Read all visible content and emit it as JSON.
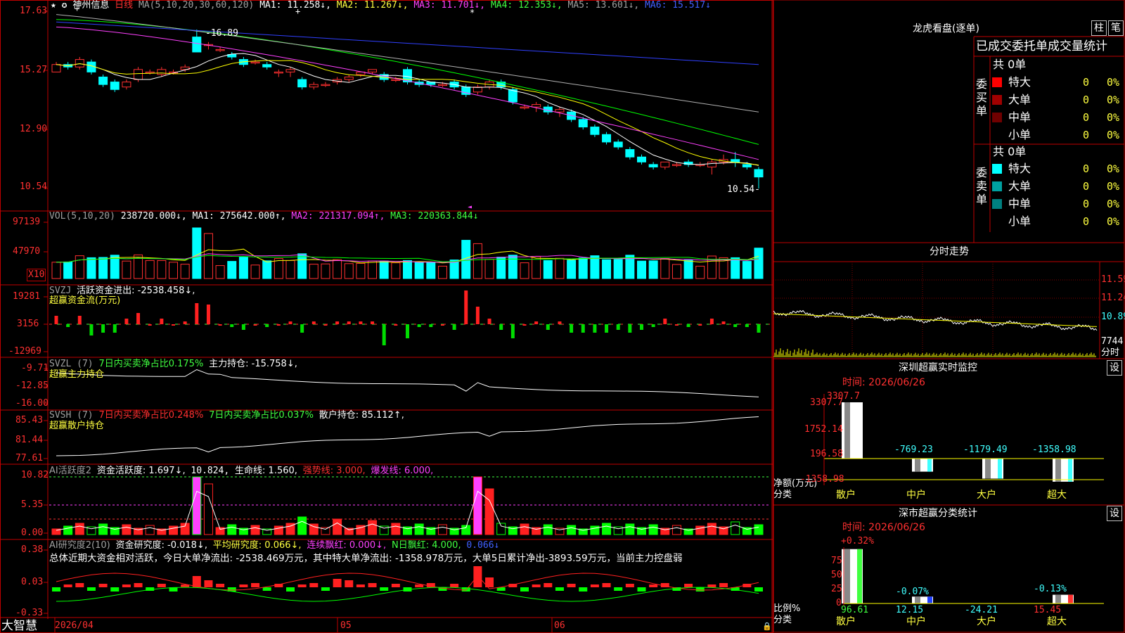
{
  "colors": {
    "up": "#ff2020",
    "down": "#00ffff",
    "border": "#c00000",
    "ma1": "#ffffff",
    "ma2": "#ffff00",
    "ma3": "#ff40ff",
    "ma4": "#00ff00",
    "ma5": "#c0c0c0",
    "ma6": "#2030ff"
  },
  "main": {
    "header": {
      "stars": "★ ✪",
      "name": "神州信息",
      "period": "日线",
      "ma_params": "MA(5,10,20,30,60,120)",
      "ma1": "MA1: 11.258↓,",
      "ma2": "MA2: 11.267↓,",
      "ma3": "MA3: 11.701↓,",
      "ma4": "MA4: 12.353↓,",
      "ma5": "MA5: 13.601↓,",
      "ma6": "MA6: 15.517↓"
    },
    "yticks": [
      "17.63",
      "15.27",
      "12.90",
      "10.54"
    ],
    "high_label": "16.89",
    "low_label": "10.54"
  },
  "vol": {
    "header": {
      "params": "VOL(5,10,20)",
      "v": "238720.000↓,",
      "ma1": "MA1: 275642.000↑,",
      "ma2": "MA2: 221317.094↑,",
      "ma3": "MA3: 220363.844↓"
    },
    "yticks": [
      "97139",
      "47970"
    ],
    "unit": "X10"
  },
  "svzj": {
    "header": {
      "name": "SVZJ",
      "l1": "活跃资金进出: -2538.458↓,",
      "l2": "超赢资金流(万元)"
    },
    "yticks": [
      "19281",
      "3156",
      "-12969"
    ]
  },
  "svzl": {
    "header": {
      "name": "SVZL (7)",
      "l1": "7日内买卖净占比0.175%",
      "l2": "主力持仓: -15.758↓,",
      "l3": "超赢主力持仓"
    },
    "yticks": [
      "-9.71",
      "-12.85",
      "-16.00"
    ]
  },
  "svsh": {
    "header": {
      "name": "SVSH (7)",
      "l1": "7日内买卖净占比0.248%",
      "l2": "7日内买卖净占比0.037%",
      "l3": "散户持仓: 85.112↑,",
      "l4": "超赢散户持仓"
    },
    "yticks": [
      "85.43",
      "81.44",
      "77.61"
    ]
  },
  "ai1": {
    "header": {
      "name": "AI活跃度2",
      "l1": "资金活跃度: 1.697↓,",
      "l2": "10.824,",
      "l3": "生命线: 1.560,",
      "l4": "强势线: 3.000,",
      "l5": "爆发线: 6.000,"
    },
    "yticks": [
      "10.82",
      "5.35",
      "0.00"
    ]
  },
  "ai2": {
    "header": {
      "name": "AI研究度2(10)",
      "l1": "资金研究度: -0.018↓,",
      "l2": "平均研究度: 0.066↓,",
      "l3": "连续飘红: 0.000↓,",
      "l4": "N日飘红: 4.000,",
      "l5": "0.066↓"
    },
    "summary": "总体近期大资金相对活跃，今日大单净流出: -2538.469万元，其中特大单净流出: -1358.978万元，大单5日累计净出-3893.59万元，当前主力控盘弱",
    "yticks": [
      "0.38",
      "0.03",
      "-0.33"
    ]
  },
  "xaxis": {
    "brand": "大智慧",
    "labels": [
      "2026/04",
      "05",
      "06"
    ]
  },
  "right": {
    "lhb": {
      "title": "龙虎看盘(逐单)",
      "btn1": "柱",
      "btn2": "笔",
      "subtitle": "已成交委托单成交量统计",
      "buy": {
        "label": "委买单",
        "total": "共 0单",
        "rows": [
          {
            "name": "特大",
            "v": "0",
            "p": "0%",
            "c": "#ff0000"
          },
          {
            "name": "大单",
            "v": "0",
            "p": "0%",
            "c": "#a00000"
          },
          {
            "name": "中单",
            "v": "0",
            "p": "0%",
            "c": "#700000"
          },
          {
            "name": "小单",
            "v": "0",
            "p": "0%",
            "c": ""
          }
        ]
      },
      "sell": {
        "label": "委卖单",
        "total": "共 0单",
        "rows": [
          {
            "name": "特大",
            "v": "0",
            "p": "0%",
            "c": "#00ffff"
          },
          {
            "name": "大单",
            "v": "0",
            "p": "0%",
            "c": "#00a0a0"
          },
          {
            "name": "中单",
            "v": "0",
            "p": "0%",
            "c": "#008080"
          },
          {
            "name": "小单",
            "v": "0",
            "p": "0%",
            "c": ""
          }
        ]
      }
    },
    "fs": {
      "title": "分时走势",
      "yticks": [
        "11.59",
        "11.24",
        "10.89",
        "7744",
        "分时"
      ]
    },
    "sz": {
      "title": "深圳超赢实时监控",
      "btn": "设",
      "time": "时间: 2026/06/26",
      "ylabel": "净额(万元)",
      "xlabel": "分类",
      "yticks": [
        "3307.7",
        "1752.14",
        "196.58",
        "-1358.98"
      ],
      "bars": [
        {
          "cat": "散户",
          "val": 3307.7,
          "label": "3307.7"
        },
        {
          "cat": "中户",
          "val": -769.23,
          "label": "-769.23"
        },
        {
          "cat": "大户",
          "val": -1179.49,
          "label": "-1179.49"
        },
        {
          "cat": "超大",
          "val": -1358.98,
          "label": "-1358.98"
        }
      ]
    },
    "ss": {
      "title": "深市超赢分类统计",
      "btn": "设",
      "time": "时间: 2026/06/26",
      "ylabel": "比例%",
      "xlabel": "分类",
      "yticks": [
        "75",
        "50",
        "25",
        "0"
      ],
      "bars": [
        {
          "cat": "散户",
          "val": 96.61,
          "top": "+0.32%",
          "bottom": "96.61"
        },
        {
          "cat": "中户",
          "val": 12.15,
          "top": "-0.07%",
          "bottom": "12.15"
        },
        {
          "cat": "大户",
          "val": 0,
          "top": "",
          "bottom": "-24.21"
        },
        {
          "cat": "超大",
          "val": 15.45,
          "top": "-0.13%",
          "bottom": "15.45"
        }
      ]
    }
  },
  "chart_data": {
    "type": "candlestick",
    "candles": [
      [
        15.2,
        15.5,
        15.2,
        15.6
      ],
      [
        15.5,
        15.4,
        15.3,
        15.6
      ],
      [
        15.4,
        15.7,
        15.3,
        15.8
      ],
      [
        15.6,
        15.2,
        15.1,
        15.7
      ],
      [
        15.0,
        14.7,
        14.6,
        15.1
      ],
      [
        14.8,
        14.5,
        14.4,
        14.9
      ],
      [
        14.6,
        14.8,
        14.5,
        14.9
      ],
      [
        14.9,
        15.3,
        14.8,
        15.4
      ],
      [
        15.2,
        15.2,
        15.1,
        15.3
      ],
      [
        15.1,
        15.3,
        15.0,
        15.4
      ],
      [
        15.2,
        15.2,
        15.1,
        15.3
      ],
      [
        15.3,
        15.4,
        15.2,
        15.5
      ],
      [
        16.6,
        16.0,
        16.0,
        16.9
      ],
      [
        16.3,
        16.3,
        16.1,
        16.4
      ],
      [
        16.1,
        16.1,
        16.0,
        16.2
      ],
      [
        15.9,
        15.8,
        15.7,
        16.0
      ],
      [
        15.7,
        15.5,
        15.4,
        15.8
      ],
      [
        15.6,
        15.6,
        15.5,
        15.7
      ],
      [
        15.5,
        15.4,
        15.3,
        15.6
      ],
      [
        15.2,
        15.2,
        15.0,
        15.3
      ],
      [
        15.2,
        15.3,
        15.0,
        15.4
      ],
      [
        14.9,
        14.6,
        14.5,
        15.0
      ],
      [
        14.6,
        14.7,
        14.5,
        14.8
      ],
      [
        14.7,
        14.7,
        14.6,
        14.8
      ],
      [
        14.8,
        14.9,
        14.7,
        15.0
      ],
      [
        14.9,
        15.0,
        14.8,
        15.1
      ],
      [
        15.1,
        15.2,
        15.0,
        15.2
      ],
      [
        15.2,
        15.3,
        15.1,
        15.3
      ],
      [
        15.1,
        14.9,
        14.8,
        15.2
      ],
      [
        14.9,
        14.9,
        14.8,
        15.0
      ],
      [
        15.3,
        14.8,
        14.7,
        15.4
      ],
      [
        14.8,
        14.7,
        14.6,
        14.9
      ],
      [
        14.8,
        14.7,
        14.6,
        14.8
      ],
      [
        14.7,
        14.7,
        14.6,
        14.8
      ],
      [
        14.8,
        14.6,
        14.5,
        14.9
      ],
      [
        14.6,
        14.3,
        14.2,
        14.7
      ],
      [
        14.4,
        14.6,
        14.3,
        14.7
      ],
      [
        14.6,
        14.8,
        14.5,
        14.9
      ],
      [
        14.8,
        14.6,
        14.5,
        14.9
      ],
      [
        14.5,
        14.0,
        13.9,
        14.6
      ],
      [
        13.8,
        13.8,
        13.7,
        13.9
      ],
      [
        13.8,
        13.9,
        13.6,
        14.0
      ],
      [
        13.8,
        13.6,
        13.5,
        13.9
      ],
      [
        13.6,
        13.7,
        13.4,
        13.8
      ],
      [
        13.6,
        13.3,
        13.2,
        13.7
      ],
      [
        13.3,
        13.0,
        12.9,
        13.4
      ],
      [
        13.0,
        12.7,
        12.6,
        13.1
      ],
      [
        12.7,
        12.4,
        12.3,
        12.8
      ],
      [
        12.4,
        12.2,
        12.1,
        12.5
      ],
      [
        12.1,
        11.8,
        11.7,
        12.2
      ],
      [
        11.8,
        11.6,
        11.5,
        11.9
      ],
      [
        11.5,
        11.4,
        11.3,
        11.6
      ],
      [
        11.4,
        11.6,
        11.3,
        11.6
      ],
      [
        11.5,
        11.5,
        11.4,
        11.6
      ],
      [
        11.6,
        11.5,
        11.4,
        11.7
      ],
      [
        11.5,
        11.5,
        11.4,
        11.6
      ],
      [
        11.4,
        11.6,
        11.1,
        11.7
      ],
      [
        11.6,
        11.7,
        11.5,
        11.9
      ],
      [
        11.7,
        11.6,
        11.4,
        12.0
      ],
      [
        11.5,
        11.4,
        11.3,
        11.6
      ],
      [
        11.3,
        11.0,
        10.54,
        11.4
      ]
    ]
  }
}
